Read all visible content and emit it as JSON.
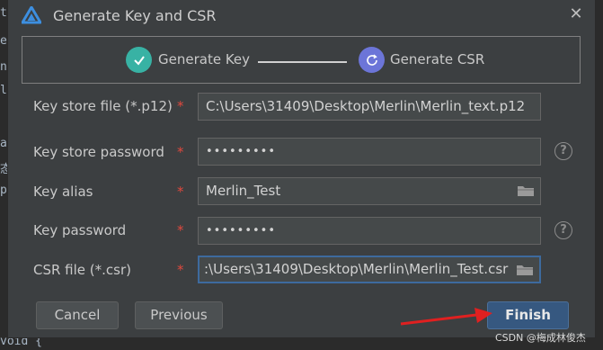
{
  "window": {
    "title": "Generate Key and CSR"
  },
  "steps": [
    {
      "label": "Generate Key",
      "status": "done",
      "color": "#38b2a4"
    },
    {
      "label": "Generate CSR",
      "status": "active",
      "color": "#6c75d8"
    }
  ],
  "form": {
    "key_store_file": {
      "label": "Key store file (*.p12)",
      "required": "*",
      "value": "C:\\Users\\31409\\Desktop\\Merlin\\Merlin_text.p12"
    },
    "key_store_password": {
      "label": "Key store password",
      "required": "*",
      "value": "•••••••••"
    },
    "key_alias": {
      "label": "Key alias",
      "required": "*",
      "value": "Merlin_Test"
    },
    "key_password": {
      "label": "Key password",
      "required": "*",
      "value": "•••••••••"
    },
    "csr_file": {
      "label": "CSR file (*.csr)",
      "required": "*",
      "value": ":\\Users\\31409\\Desktop\\Merlin\\Merlin_Test.csr"
    }
  },
  "buttons": {
    "cancel": "Cancel",
    "previous": "Previous",
    "finish": "Finish"
  },
  "help_glyph": "?",
  "close_glyph": "✕",
  "background_editor": {
    "chars": [
      "t",
      "e",
      "n",
      "l",
      "a",
      "态",
      "p"
    ],
    "bottom_line": "void {"
  },
  "watermark": "CSDN @梅成林俊杰",
  "colors": {
    "accent": "#365880",
    "required": "#e0483e",
    "annotation_arrow": "#e02020"
  }
}
